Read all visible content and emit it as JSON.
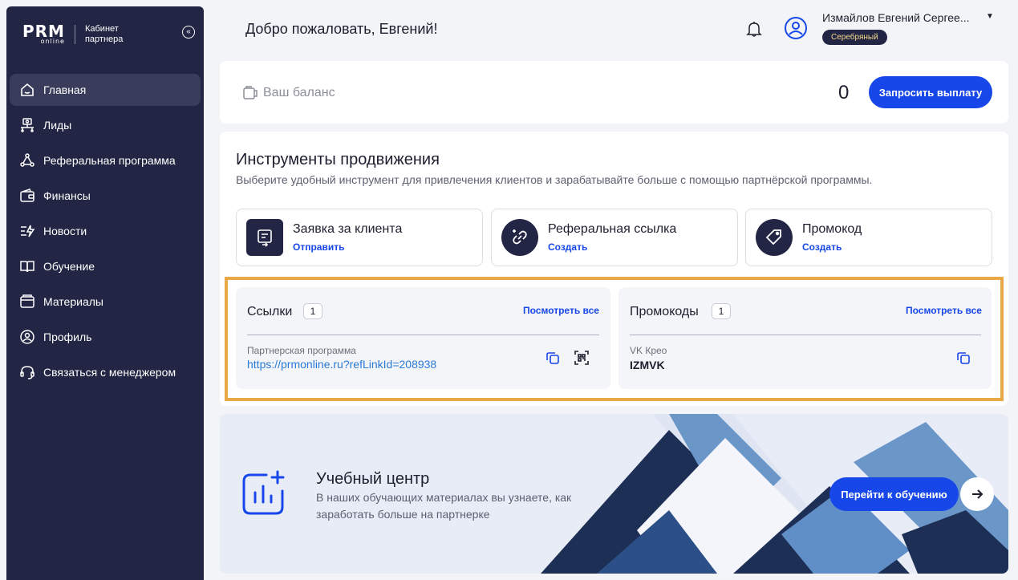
{
  "sidebar": {
    "logo_main": "PRM",
    "logo_small": "online",
    "logo_sub_line1": "Кабинет",
    "logo_sub_line2": "партнера",
    "collapse_glyph": "«",
    "items": [
      {
        "label": "Главная",
        "icon": "home-icon",
        "active": true
      },
      {
        "label": "Лиды",
        "icon": "leads-icon"
      },
      {
        "label": "Реферальная программа",
        "icon": "referral-icon"
      },
      {
        "label": "Финансы",
        "icon": "wallet-icon"
      },
      {
        "label": "Новости",
        "icon": "news-icon"
      },
      {
        "label": "Обучение",
        "icon": "book-icon"
      },
      {
        "label": "Материалы",
        "icon": "folder-icon"
      },
      {
        "label": "Профиль",
        "icon": "profile-icon"
      },
      {
        "label": "Связаться с менеджером",
        "icon": "headset-icon"
      }
    ]
  },
  "header": {
    "welcome": "Добро пожаловать, Евгений!",
    "user_name": "Измайлов Евгений Сергее...",
    "caret": "▼",
    "tier": "Серебряный"
  },
  "balance": {
    "label": "Ваш баланс",
    "value": "0",
    "payout_button": "Запросить выплату"
  },
  "tools": {
    "title": "Инструменты продвижения",
    "subtitle": "Выберите удобный инструмент для привлечения клиентов и зарабатывайте больше с помощью партнёрской программы.",
    "cards": [
      {
        "name": "Заявка за клиента",
        "action": "Отправить"
      },
      {
        "name": "Реферальная ссылка",
        "action": "Создать"
      },
      {
        "name": "Промокод",
        "action": "Создать"
      }
    ]
  },
  "links_panel": {
    "title": "Ссылки",
    "count": "1",
    "see_all": "Посмотреть все",
    "item_caption": "Партнерская программа",
    "item_url": "https://prmonline.ru?refLinkId=208938"
  },
  "promo_panel": {
    "title": "Промокоды",
    "count": "1",
    "see_all": "Посмотреть все",
    "item_caption": "VK Крео",
    "item_code": "IZMVK"
  },
  "education": {
    "title": "Учебный центр",
    "text": "В наших обучающих материалах вы узнаете, как заработать больше на партнерке",
    "button": "Перейти к обучению"
  },
  "colors": {
    "sidebar_bg": "#232544",
    "accent": "#1747e8",
    "highlight": "#e8a845",
    "tier_text": "#f4d98a"
  }
}
